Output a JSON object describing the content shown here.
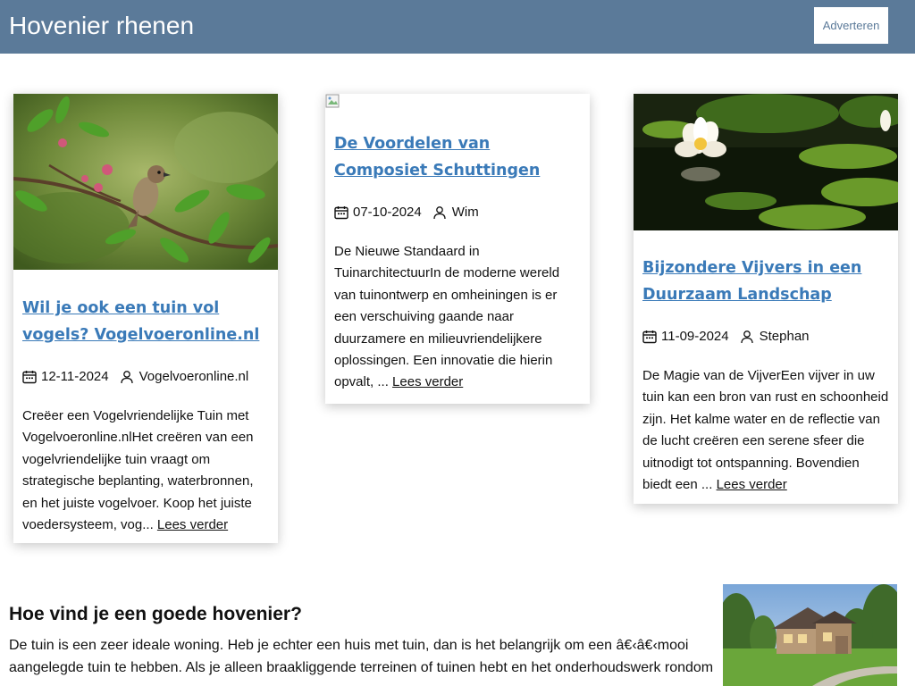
{
  "header": {
    "site_title": "Hovenier rhenen",
    "advert_label": "Adverteren",
    "bg_color": "#5b7a99"
  },
  "cards": [
    {
      "image_icon": "bird-on-branch-photo",
      "title": "Wil je ook een tuin vol vogels? Vogelvoeronline.nl",
      "date": "12-11-2024",
      "author": "Vogelvoeronline.nl",
      "excerpt": "Creëer een Vogelvriendelijke Tuin met Vogelvoeronline.nlHet creëren van een vogelvriendelijke tuin vraagt om strategische beplanting, waterbronnen, en het juiste vogelvoer. Koop het juiste voedersysteem, vog... ",
      "read_more": "Lees verder"
    },
    {
      "image_icon": "broken-image-icon",
      "title": "De Voordelen van Composiet Schuttingen",
      "date": "07-10-2024",
      "author": "Wim",
      "excerpt": "De Nieuwe Standaard in TuinarchitectuurIn de moderne wereld van tuinontwerp en omheiningen is er een verschuiving gaande naar duurzamere en milieuvriendelijkere oplossingen. Een innovatie die hierin opvalt, ... ",
      "read_more": "Lees verder"
    },
    {
      "image_icon": "water-lily-photo",
      "title": "Bijzondere Vijvers in een Duurzaam Landschap",
      "date": "11-09-2024",
      "author": "Stephan",
      "excerpt": "De Magie van de VijverEen vijver in uw tuin kan een bron van rust en schoonheid zijn. Het kalme water en de reflectie van de lucht creëren een serene sfeer die uitnodigt tot ontspanning. Bovendien biedt een ... ",
      "read_more": "Lees verder"
    }
  ],
  "section": {
    "title": "Hoe vind je een goede hovenier?",
    "text": "De tuin is een zeer ideale woning. Heb je echter een huis met tuin, dan is het belangrijk om een â€‹â€‹mooi aangelegde tuin te hebben. Als je alleen braakliggende terreinen of tuinen hebt en het onderhoudswerk rondom",
    "image_icon": "house-with-garden-photo"
  },
  "colors": {
    "link": "#3a7ab8",
    "text": "#111111"
  }
}
